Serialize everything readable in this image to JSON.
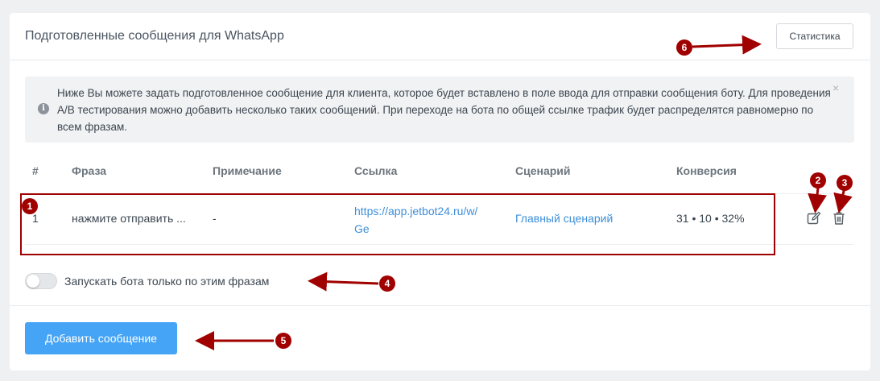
{
  "header": {
    "title": "Подготовленные сообщения для WhatsApp",
    "stats_button": "Статистика"
  },
  "alert": {
    "icon": "info-icon",
    "icon_glyph": "i",
    "text": "Ниже Вы можете задать подготовленное сообщение для клиента, которое будет вставлено в поле ввода для отправки сообщения боту. Для проведения A/B тестирования можно добавить несколько таких сообщений. При переходе на бота по общей ссылке трафик будет распределятся равномерно по всем фразам.",
    "close_glyph": "×"
  },
  "table": {
    "columns": [
      "#",
      "Фраза",
      "Примечание",
      "Ссылка",
      "Сценарий",
      "Конверсия"
    ],
    "rows": [
      {
        "num": "1",
        "phrase": "нажмите отправить ...",
        "note": "-",
        "link_line1": "https://app.jetbot24.ru/w/",
        "link_line2": "Ge",
        "scenario": "Главный сценарий",
        "conversion": "31 • 10 • 32%"
      }
    ]
  },
  "toggle": {
    "label": "Запускать бота только по этим фразам",
    "on": false
  },
  "add_button": "Добавить сообщение",
  "annotations": [
    "1",
    "2",
    "3",
    "4",
    "5",
    "6"
  ],
  "colors": {
    "accent": "#45a4f5",
    "link": "#3d8fd9",
    "annotation": "#a00000"
  }
}
